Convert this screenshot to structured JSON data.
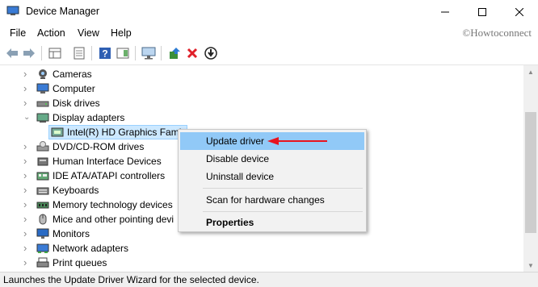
{
  "window": {
    "title": "Device Manager"
  },
  "menu": [
    "File",
    "Action",
    "View",
    "Help"
  ],
  "watermark": "©Howtoconnect",
  "toolbar": {
    "icons": [
      "back-arrow-icon",
      "forward-arrow-icon",
      "properties-grid-icon",
      "console-tree-icon",
      "help-icon",
      "action-pane-icon",
      "monitor-icon",
      "update-driver-icon",
      "uninstall-device-icon",
      "disable-device-icon"
    ]
  },
  "tree": {
    "items": [
      {
        "label": "Cameras",
        "icon": "camera-icon"
      },
      {
        "label": "Computer",
        "icon": "computer-icon"
      },
      {
        "label": "Disk drives",
        "icon": "disk-drive-icon"
      },
      {
        "label": "Display adapters",
        "icon": "display-adapter-icon",
        "expanded": true
      },
      {
        "label": "Intel(R) HD Graphics Fami",
        "icon": "graphics-card-icon",
        "selected": true,
        "child": true
      },
      {
        "label": "DVD/CD-ROM drives",
        "icon": "dvd-drive-icon"
      },
      {
        "label": "Human Interface Devices",
        "icon": "hid-icon"
      },
      {
        "label": "IDE ATA/ATAPI controllers",
        "icon": "ide-controller-icon"
      },
      {
        "label": "Keyboards",
        "icon": "keyboard-icon"
      },
      {
        "label": "Memory technology devices",
        "icon": "memory-icon"
      },
      {
        "label": "Mice and other pointing devi",
        "icon": "mouse-icon"
      },
      {
        "label": "Monitors",
        "icon": "monitor-icon"
      },
      {
        "label": "Network adapters",
        "icon": "network-adapter-icon"
      },
      {
        "label": "Print queues",
        "icon": "printer-icon"
      }
    ]
  },
  "context_menu": {
    "items": [
      {
        "label": "Update driver",
        "highlighted": true
      },
      {
        "label": "Disable device"
      },
      {
        "label": "Uninstall device"
      },
      {
        "label": "Scan for hardware changes"
      },
      {
        "label": "Properties",
        "bold": true
      }
    ]
  },
  "accent": "#e8131f",
  "status": "Launches the Update Driver Wizard for the selected device."
}
